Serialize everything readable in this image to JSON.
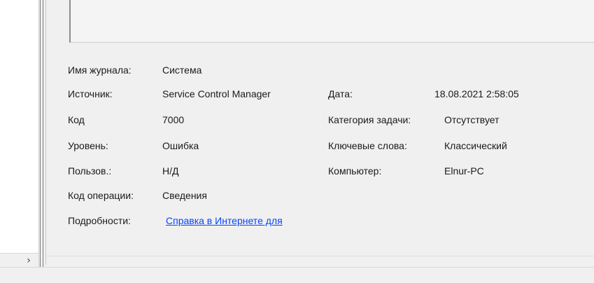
{
  "details": {
    "log_name": {
      "label": "Имя журнала:",
      "value": "Система"
    },
    "source": {
      "label": "Источник:",
      "value": "Service Control Manager"
    },
    "date": {
      "label": "Дата:",
      "value": "18.08.2021 2:58:05"
    },
    "event_id": {
      "label": "Код",
      "value": "7000"
    },
    "task_category": {
      "label": "Категория задачи:",
      "value": "Отсутствует"
    },
    "level": {
      "label": "Уровень:",
      "value": "Ошибка"
    },
    "keywords": {
      "label": "Ключевые слова:",
      "value": "Классический"
    },
    "user": {
      "label": "Пользов.:",
      "value": "Н/Д"
    },
    "computer": {
      "label": "Компьютер:",
      "value": "Elnur-PC"
    },
    "opcode": {
      "label": "Код операции:",
      "value": "Сведения"
    },
    "more_info": {
      "label": "Подробности:",
      "link": "Справка в Интернете для "
    }
  },
  "icons": {
    "scroll_right": "›"
  }
}
